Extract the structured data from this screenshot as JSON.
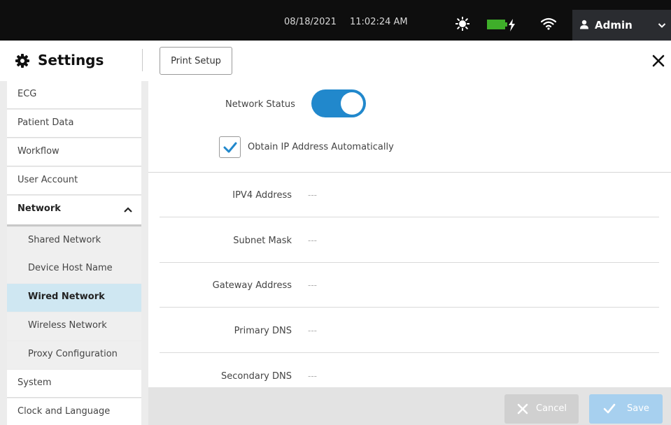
{
  "status_bar": {
    "date": "08/18/2021",
    "time": "11:02:24 AM",
    "user_name": "Admin",
    "battery_color": "#3fae2a"
  },
  "header": {
    "title": "Settings",
    "print_setup_label": "Print Setup"
  },
  "sidebar": {
    "items": [
      {
        "label": "ECG"
      },
      {
        "label": "Patient Data"
      },
      {
        "label": "Workflow"
      },
      {
        "label": "User Account"
      },
      {
        "label": "Network",
        "expanded": true
      },
      {
        "label": "Shared Network"
      },
      {
        "label": "Device Host Name"
      },
      {
        "label": "Wired Network",
        "selected": true
      },
      {
        "label": "Wireless Network"
      },
      {
        "label": "Proxy Configuration"
      },
      {
        "label": "System"
      },
      {
        "label": "Clock and Language"
      }
    ]
  },
  "main": {
    "network_status_label": "Network Status",
    "network_status_on": true,
    "obtain_ip_label": "Obtain IP Address Automatically",
    "obtain_ip_checked": true,
    "fields": [
      {
        "label": "IPV4 Address",
        "value": "---"
      },
      {
        "label": "Subnet Mask",
        "value": "---"
      },
      {
        "label": "Gateway Address",
        "value": "---"
      },
      {
        "label": "Primary DNS",
        "value": "---"
      },
      {
        "label": "Secondary DNS",
        "value": "---"
      }
    ]
  },
  "footer": {
    "cancel_label": "Cancel",
    "save_label": "Save"
  },
  "colors": {
    "accent": "#2188cc",
    "selected_bg": "#cfe7f2",
    "topbar_bg": "#0e0e0e"
  }
}
